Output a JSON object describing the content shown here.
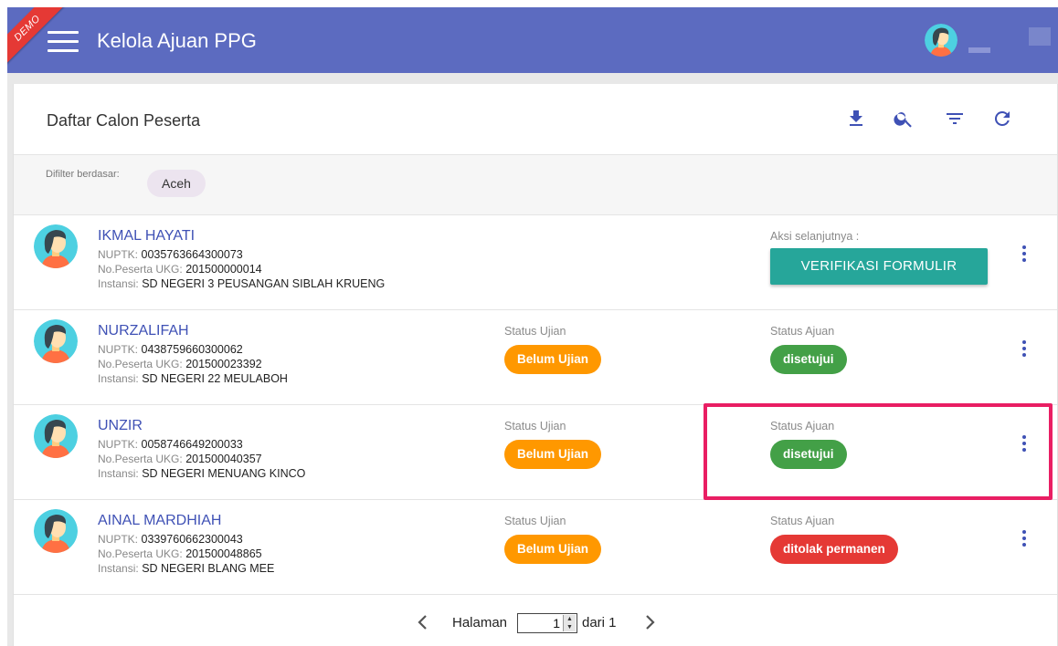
{
  "appbar": {
    "demo_label": "DEMO",
    "title": "Kelola Ajuan PPG"
  },
  "card": {
    "title": "Daftar Calon Peserta",
    "actions": [
      "download-icon",
      "search-icon",
      "filter-icon",
      "refresh-icon"
    ],
    "accent_color": "#3f51b5"
  },
  "filter": {
    "label": "Difilter berdasar:",
    "chip": "Aceh"
  },
  "labels": {
    "nuptk": "NUPTK:",
    "no_peserta": "No.Peserta UKG:",
    "instansi": "Instansi:",
    "status_ujian": "Status Ujian",
    "status_ajuan": "Status Ajuan",
    "aksi": "Aksi selanjutnya :"
  },
  "rows": [
    {
      "name": "IKMAL HAYATI",
      "nuptk": "0035763664300073",
      "no_peserta": "201500000014",
      "instansi": "SD NEGERI 3 PEUSANGAN SIBLAH KRUENG",
      "action_button": "VERIFIKASI FORMULIR"
    },
    {
      "name": "NURZALIFAH",
      "nuptk": "0438759660300062",
      "no_peserta": "201500023392",
      "instansi": "SD NEGERI 22 MEULABOH",
      "status_ujian": "Belum Ujian",
      "status_ajuan": "disetujui"
    },
    {
      "name": "UNZIR",
      "nuptk": "0058746649200033",
      "no_peserta": "201500040357",
      "instansi": "SD NEGERI MENUANG KINCO",
      "status_ujian": "Belum Ujian",
      "status_ajuan": "disetujui"
    },
    {
      "name": "AINAL MARDHIAH",
      "nuptk": "0339760662300043",
      "no_peserta": "201500048865",
      "instansi": "SD NEGERI BLANG MEE",
      "status_ujian": "Belum Ujian",
      "status_ajuan": "ditolak permanen"
    }
  ],
  "pager": {
    "label": "Halaman",
    "current": "1",
    "of": "dari 1"
  },
  "colors": {
    "appbar": "#5c6bc0",
    "status_pending": "#ff9800",
    "status_approved": "#43a047",
    "status_rejected": "#e53935",
    "action_button": "#26a69a",
    "highlight": "#e91e63"
  }
}
